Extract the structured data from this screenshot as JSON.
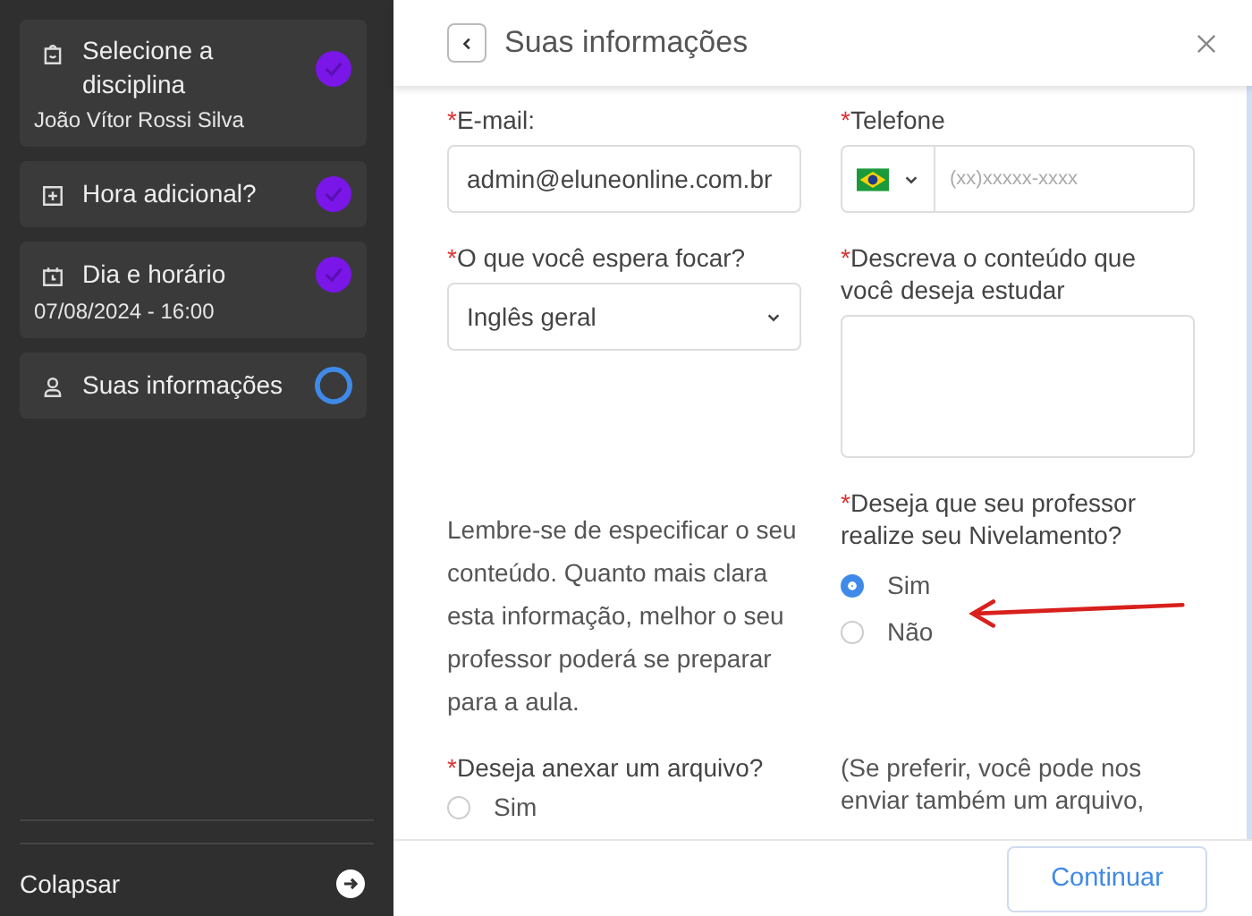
{
  "sidebar": {
    "steps": [
      {
        "title": "Selecione a disciplina",
        "subtitle": "João Vítor Rossi Silva",
        "completed": true
      },
      {
        "title": "Hora adicional?",
        "completed": true
      },
      {
        "title": "Dia e horário",
        "subtitle": "07/08/2024 - 16:00",
        "completed": true
      },
      {
        "title": "Suas informações",
        "completed": false
      }
    ],
    "collapse_label": "Colapsar"
  },
  "panel": {
    "title": "Suas informações",
    "email": {
      "label": "E-mail:",
      "required_mark": "*",
      "value": "admin@eluneonline.com.br"
    },
    "phone": {
      "label": "Telefone",
      "required_mark": "*",
      "placeholder": "(xx)xxxxx-xxxx"
    },
    "focus": {
      "label": "O que você espera focar?",
      "required_mark": "*",
      "value": "Inglês geral"
    },
    "content": {
      "label": "Descreva o conteúdo que você deseja estudar",
      "required_mark": "*"
    },
    "hint": "Lembre-se de especificar o seu conteúdo. Quanto mais clara esta informação, melhor o seu professor poderá se preparar para a aula.",
    "leveling": {
      "label": "Deseja que seu professor realize seu Nivelamento?",
      "required_mark": "*",
      "options": [
        {
          "label": "Sim",
          "selected": true
        },
        {
          "label": "Não",
          "selected": false
        }
      ]
    },
    "attach": {
      "label": "Deseja anexar um arquivo?",
      "required_mark": "*",
      "options": [
        {
          "label": "Sim",
          "selected": false
        }
      ]
    },
    "attach_note": "(Se preferir, você pode nos enviar também um arquivo,",
    "continue_button": "Continuar"
  }
}
